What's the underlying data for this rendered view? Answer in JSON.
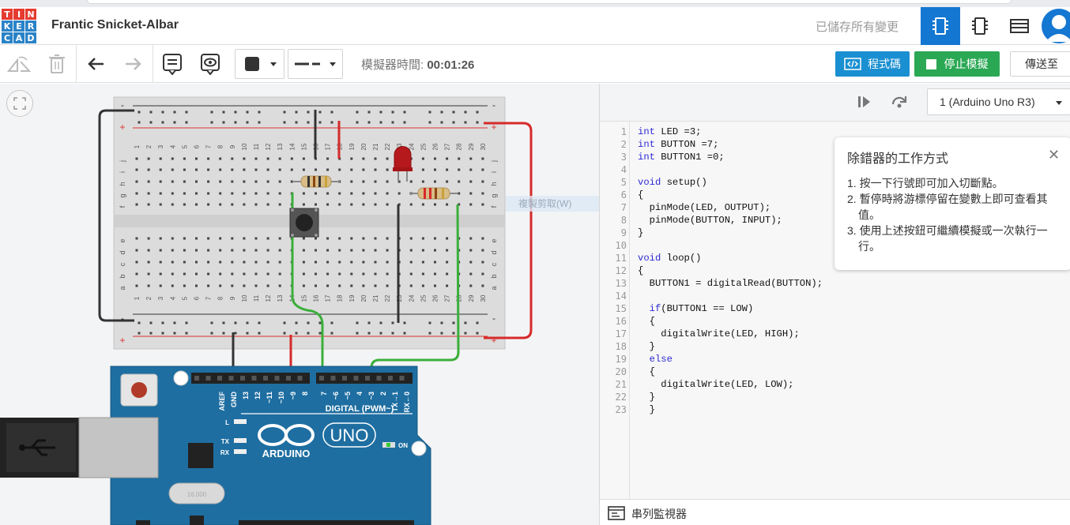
{
  "app": {
    "logo_letters": [
      "T",
      "I",
      "N",
      "K",
      "E",
      "R",
      "C",
      "A",
      "D"
    ],
    "logo_colors": [
      "#e53b30",
      "#e53b30",
      "#e53b30",
      "#2a83c7",
      "#2a83c7",
      "#2a83c7",
      "#2a83c7",
      "#2a83c7",
      "#2a83c7"
    ],
    "project_title": "Frantic Snicket-Albar",
    "save_status": "已儲存所有變更"
  },
  "header_buttons": [
    {
      "name": "circuit-view-icon",
      "active": true
    },
    {
      "name": "chip-view-icon",
      "active": false
    },
    {
      "name": "list-view-icon",
      "active": false
    }
  ],
  "toolbar": {
    "sim_time_label": "模擬器時間: ",
    "sim_time_value": "00:01:26",
    "code_button": "程式碼",
    "stop_button": "停止模擬",
    "send_button": "傳送至"
  },
  "code_panel": {
    "board_select": "1 (Arduino Uno R3)",
    "serial_monitor": "串列監視器",
    "lines": [
      "int LED =3;",
      "int BUTTON =7;",
      "int BUTTON1 =0;",
      "",
      "void setup()",
      "{",
      "  pinMode(LED, OUTPUT);",
      "  pinMode(BUTTON, INPUT);",
      "}",
      "",
      "void loop()",
      "{",
      "  BUTTON1 = digitalRead(BUTTON);",
      "",
      "  if(BUTTON1 == LOW)",
      "  {",
      "    digitalWrite(LED, HIGH);",
      "  }",
      "  else",
      "  {",
      "    digitalWrite(LED, LOW);",
      "  }",
      "  }"
    ]
  },
  "debugger_tip": {
    "title": "除錯器的工作方式",
    "items": [
      "1. 按一下行號即可加入切斷點。",
      "2. 暫停時將游標停留在變數上即可查看其值。",
      "3. 使用上述按鈕可繼續模擬或一次執行一行。"
    ]
  },
  "hover_hint": "複製剪取(W)",
  "breadboard": {
    "columns": [
      "1",
      "2",
      "3",
      "4",
      "5",
      "6",
      "7",
      "8",
      "9",
      "10",
      "11",
      "12",
      "13",
      "14",
      "15",
      "16",
      "17",
      "18",
      "19",
      "20",
      "21",
      "22",
      "23",
      "24",
      "25",
      "26",
      "27",
      "28",
      "29",
      "30"
    ],
    "rows_top": [
      "j",
      "i",
      "h",
      "g",
      "f"
    ],
    "rows_bottom": [
      "e",
      "d",
      "c",
      "b",
      "a"
    ],
    "rail_plus": "+",
    "rail_minus": "-"
  },
  "arduino": {
    "digital_label": "DIGITAL (PWM~)",
    "brand": "ARDUINO",
    "model": "UNO",
    "on_label": "ON",
    "pin_labels": [
      "AREF",
      "GND",
      "13",
      "12",
      "~11",
      "~10",
      "~9",
      "8",
      "7",
      "~6",
      "~5",
      "4",
      "~3",
      "2",
      "TX→1",
      "RX←0"
    ],
    "led_labels": [
      "L",
      "TX",
      "RX"
    ],
    "crystal_label": "16.000"
  }
}
